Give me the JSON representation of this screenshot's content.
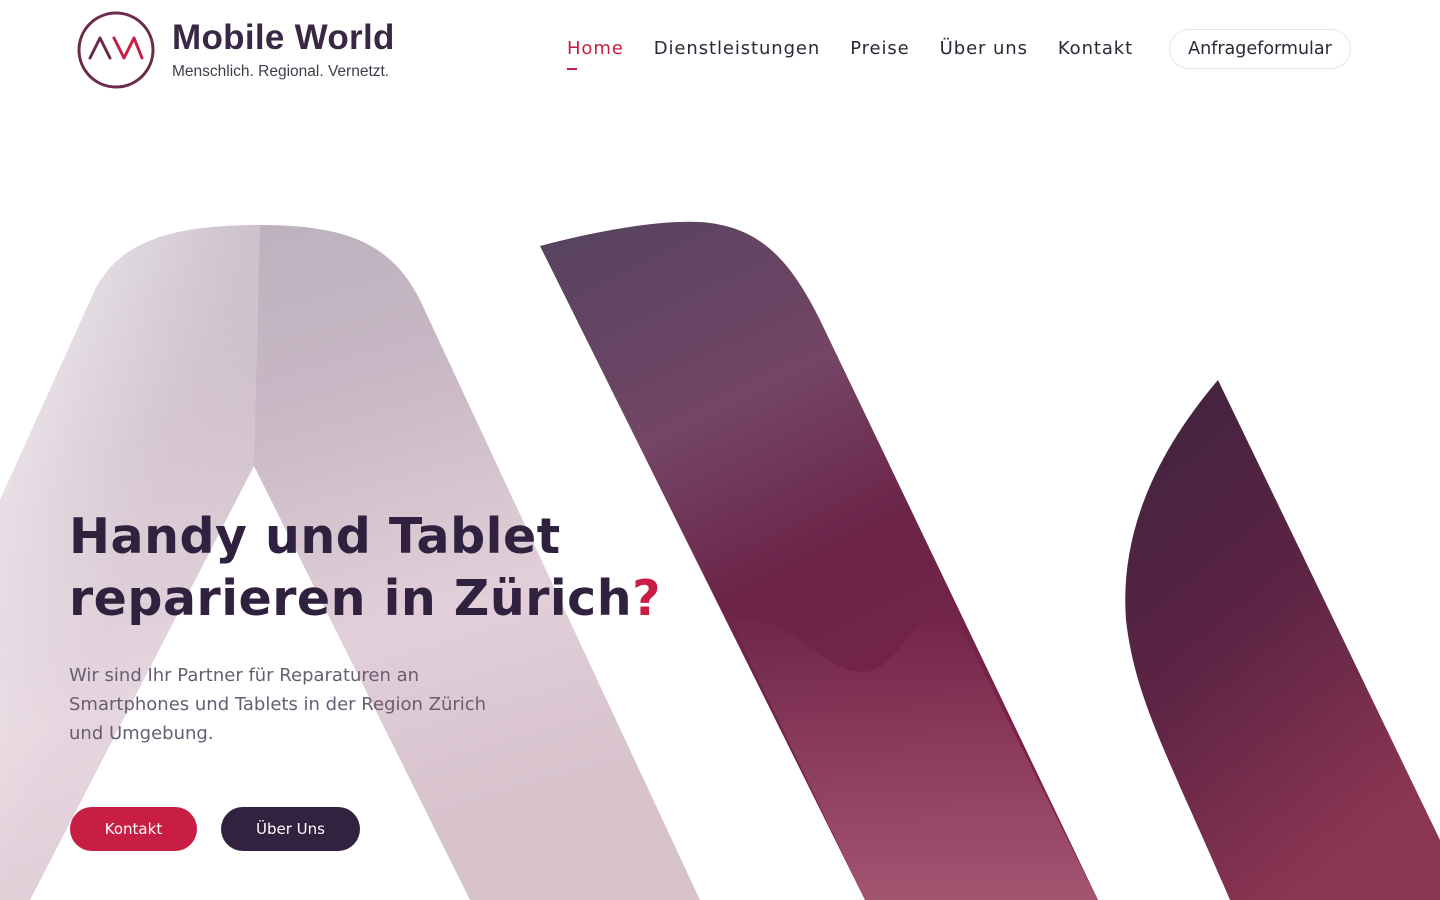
{
  "brand": {
    "name": "Mobile World",
    "tagline": "Menschlich. Regional. Vernetzt.",
    "logo_icon": "mw-logo-icon",
    "colors": {
      "primary": "#c81e43",
      "dark": "#32213f"
    }
  },
  "nav": {
    "items": [
      {
        "label": "Home",
        "active": true
      },
      {
        "label": "Dienstleistungen",
        "active": false
      },
      {
        "label": "Preise",
        "active": false
      },
      {
        "label": "Über uns",
        "active": false
      },
      {
        "label": "Kontakt",
        "active": false
      }
    ],
    "cta_label": "Anfrageformular"
  },
  "hero": {
    "title_line1": "Handy und Tablet",
    "title_line2": "reparieren in Zürich",
    "title_mark": "?",
    "text": "Wir sind Ihr Partner für Reparaturen an Smartphones und Tablets in der Region Zürich und Umgebung.",
    "primary_button": "Kontakt",
    "secondary_button": "Über Uns"
  }
}
